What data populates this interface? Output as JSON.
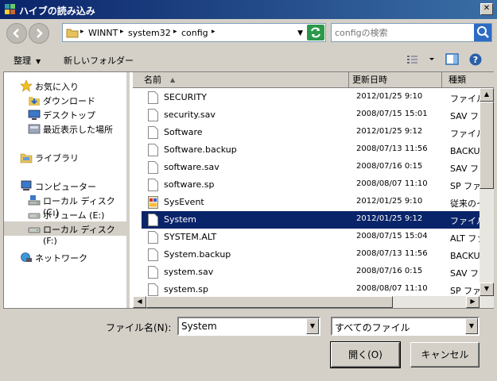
{
  "window": {
    "title": "ハイブの読み込み",
    "close": "✕"
  },
  "address": {
    "crumbs": [
      "WINNT",
      "system32",
      "config"
    ]
  },
  "search": {
    "placeholder": "configの検索"
  },
  "toolbar": {
    "organize": "整理",
    "new_folder": "新しいフォルダー"
  },
  "sidebar": {
    "favorites": "お気に入り",
    "downloads": "ダウンロード",
    "desktop": "デスクトップ",
    "recent": "最近表示した場所",
    "libraries": "ライブラリ",
    "computer": "コンピューター",
    "local_c": "ローカル ディスク (C:)",
    "volume_e": "ボリューム (E:)",
    "local_f": "ローカル ディスク (F:)",
    "network": "ネットワーク"
  },
  "columns": {
    "name": "名前",
    "date": "更新日時",
    "type": "種類"
  },
  "files": [
    {
      "name": "SECURITY",
      "date": "2012/01/25 9:10",
      "type": "ファイル"
    },
    {
      "name": "security.sav",
      "date": "2008/07/15 15:01",
      "type": "SAV ファイル"
    },
    {
      "name": "Software",
      "date": "2012/01/25 9:12",
      "type": "ファイル"
    },
    {
      "name": "Software.backup",
      "date": "2008/07/13 11:56",
      "type": "BACKUP ファイル"
    },
    {
      "name": "software.sav",
      "date": "2008/07/16 0:15",
      "type": "SAV ファイル"
    },
    {
      "name": "software.sp",
      "date": "2008/08/07 11:10",
      "type": "SP ファイル"
    },
    {
      "name": "SysEvent",
      "date": "2012/01/25 9:10",
      "type": "従来のイベント ログ"
    },
    {
      "name": "System",
      "date": "2012/01/25 9:12",
      "type": "ファイル"
    },
    {
      "name": "SYSTEM.ALT",
      "date": "2008/07/15 15:04",
      "type": "ALT ファイル"
    },
    {
      "name": "System.backup",
      "date": "2008/07/13 11:56",
      "type": "BACKUP ファイル"
    },
    {
      "name": "system.sav",
      "date": "2008/07/16 0:15",
      "type": "SAV ファイル"
    },
    {
      "name": "system.sp",
      "date": "2008/08/07 11:10",
      "type": "SP ファイル"
    }
  ],
  "selected_file": "System",
  "bottom": {
    "filename_label": "ファイル名(N):",
    "filename_value": "System",
    "filter_value": "すべてのファイル",
    "open": "開く(O)",
    "cancel": "キャンセル"
  },
  "colors": {
    "title_start": "#0a246a",
    "title_end": "#3a6ea5",
    "selection": "#0a246a",
    "chrome": "#d4d0c8"
  }
}
